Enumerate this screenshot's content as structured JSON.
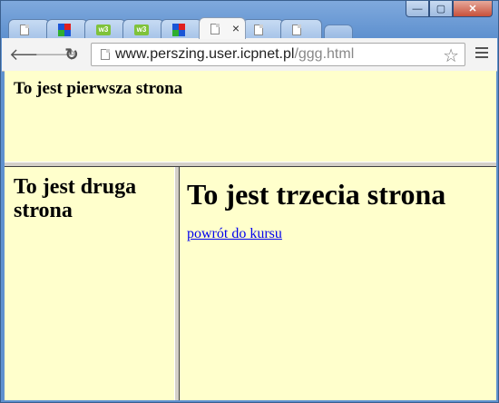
{
  "browser": {
    "tabs": [
      {
        "icon": "document-icon",
        "active": false
      },
      {
        "icon": "grid-logo-icon",
        "active": false
      },
      {
        "icon": "w3c-icon",
        "active": false,
        "label": "w3"
      },
      {
        "icon": "w3c-icon",
        "active": false,
        "label": "w3"
      },
      {
        "icon": "grid-logo-icon",
        "active": false
      },
      {
        "icon": "document-icon",
        "active": true,
        "close": "×"
      },
      {
        "icon": "document-icon",
        "active": false
      },
      {
        "icon": "document-icon",
        "active": false
      }
    ],
    "window_controls": {
      "minimize": "—",
      "maximize": "▢",
      "close": "✕"
    },
    "url": {
      "host": "www.perszing.user.icpnet.pl",
      "path": "/ggg.html"
    }
  },
  "page": {
    "top_frame": {
      "text": "To jest pierwsza strona"
    },
    "left_frame": {
      "text": "To jest druga strona"
    },
    "right_frame": {
      "heading": "To jest trzecia strona",
      "link": "powrót do kursu"
    }
  },
  "colors": {
    "frame_background": "#ffffcc",
    "link": "#0000ee"
  }
}
